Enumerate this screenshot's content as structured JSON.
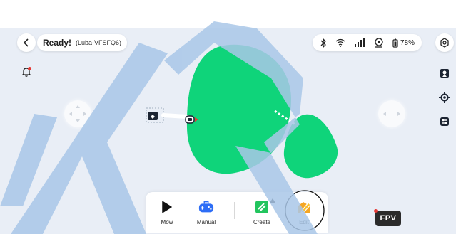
{
  "status": {
    "main": "Ready!",
    "device": "(Luba-VFSFQ6)"
  },
  "battery": "78%",
  "toolbar": {
    "mow": "Mow",
    "manual": "Manual",
    "create": "Create",
    "edit": "Edit"
  },
  "fpv": "FPV",
  "watermark": "KR",
  "colors": {
    "map_background": "#e9eef6",
    "zone_fill": "#0fd47a",
    "edit_accent": "#f5a623",
    "watermark": "#a9c7e8",
    "notification_dot": "#e53935"
  },
  "icons": [
    "back-arrow-icon",
    "bluetooth-icon",
    "wifi-icon",
    "cellular-signal-icon",
    "gps-icon",
    "battery-icon",
    "settings-icon",
    "bell-icon",
    "map-icon",
    "locate-icon",
    "layers-icon",
    "play-icon",
    "gamepad-icon",
    "create-zone-icon",
    "edit-icon"
  ]
}
